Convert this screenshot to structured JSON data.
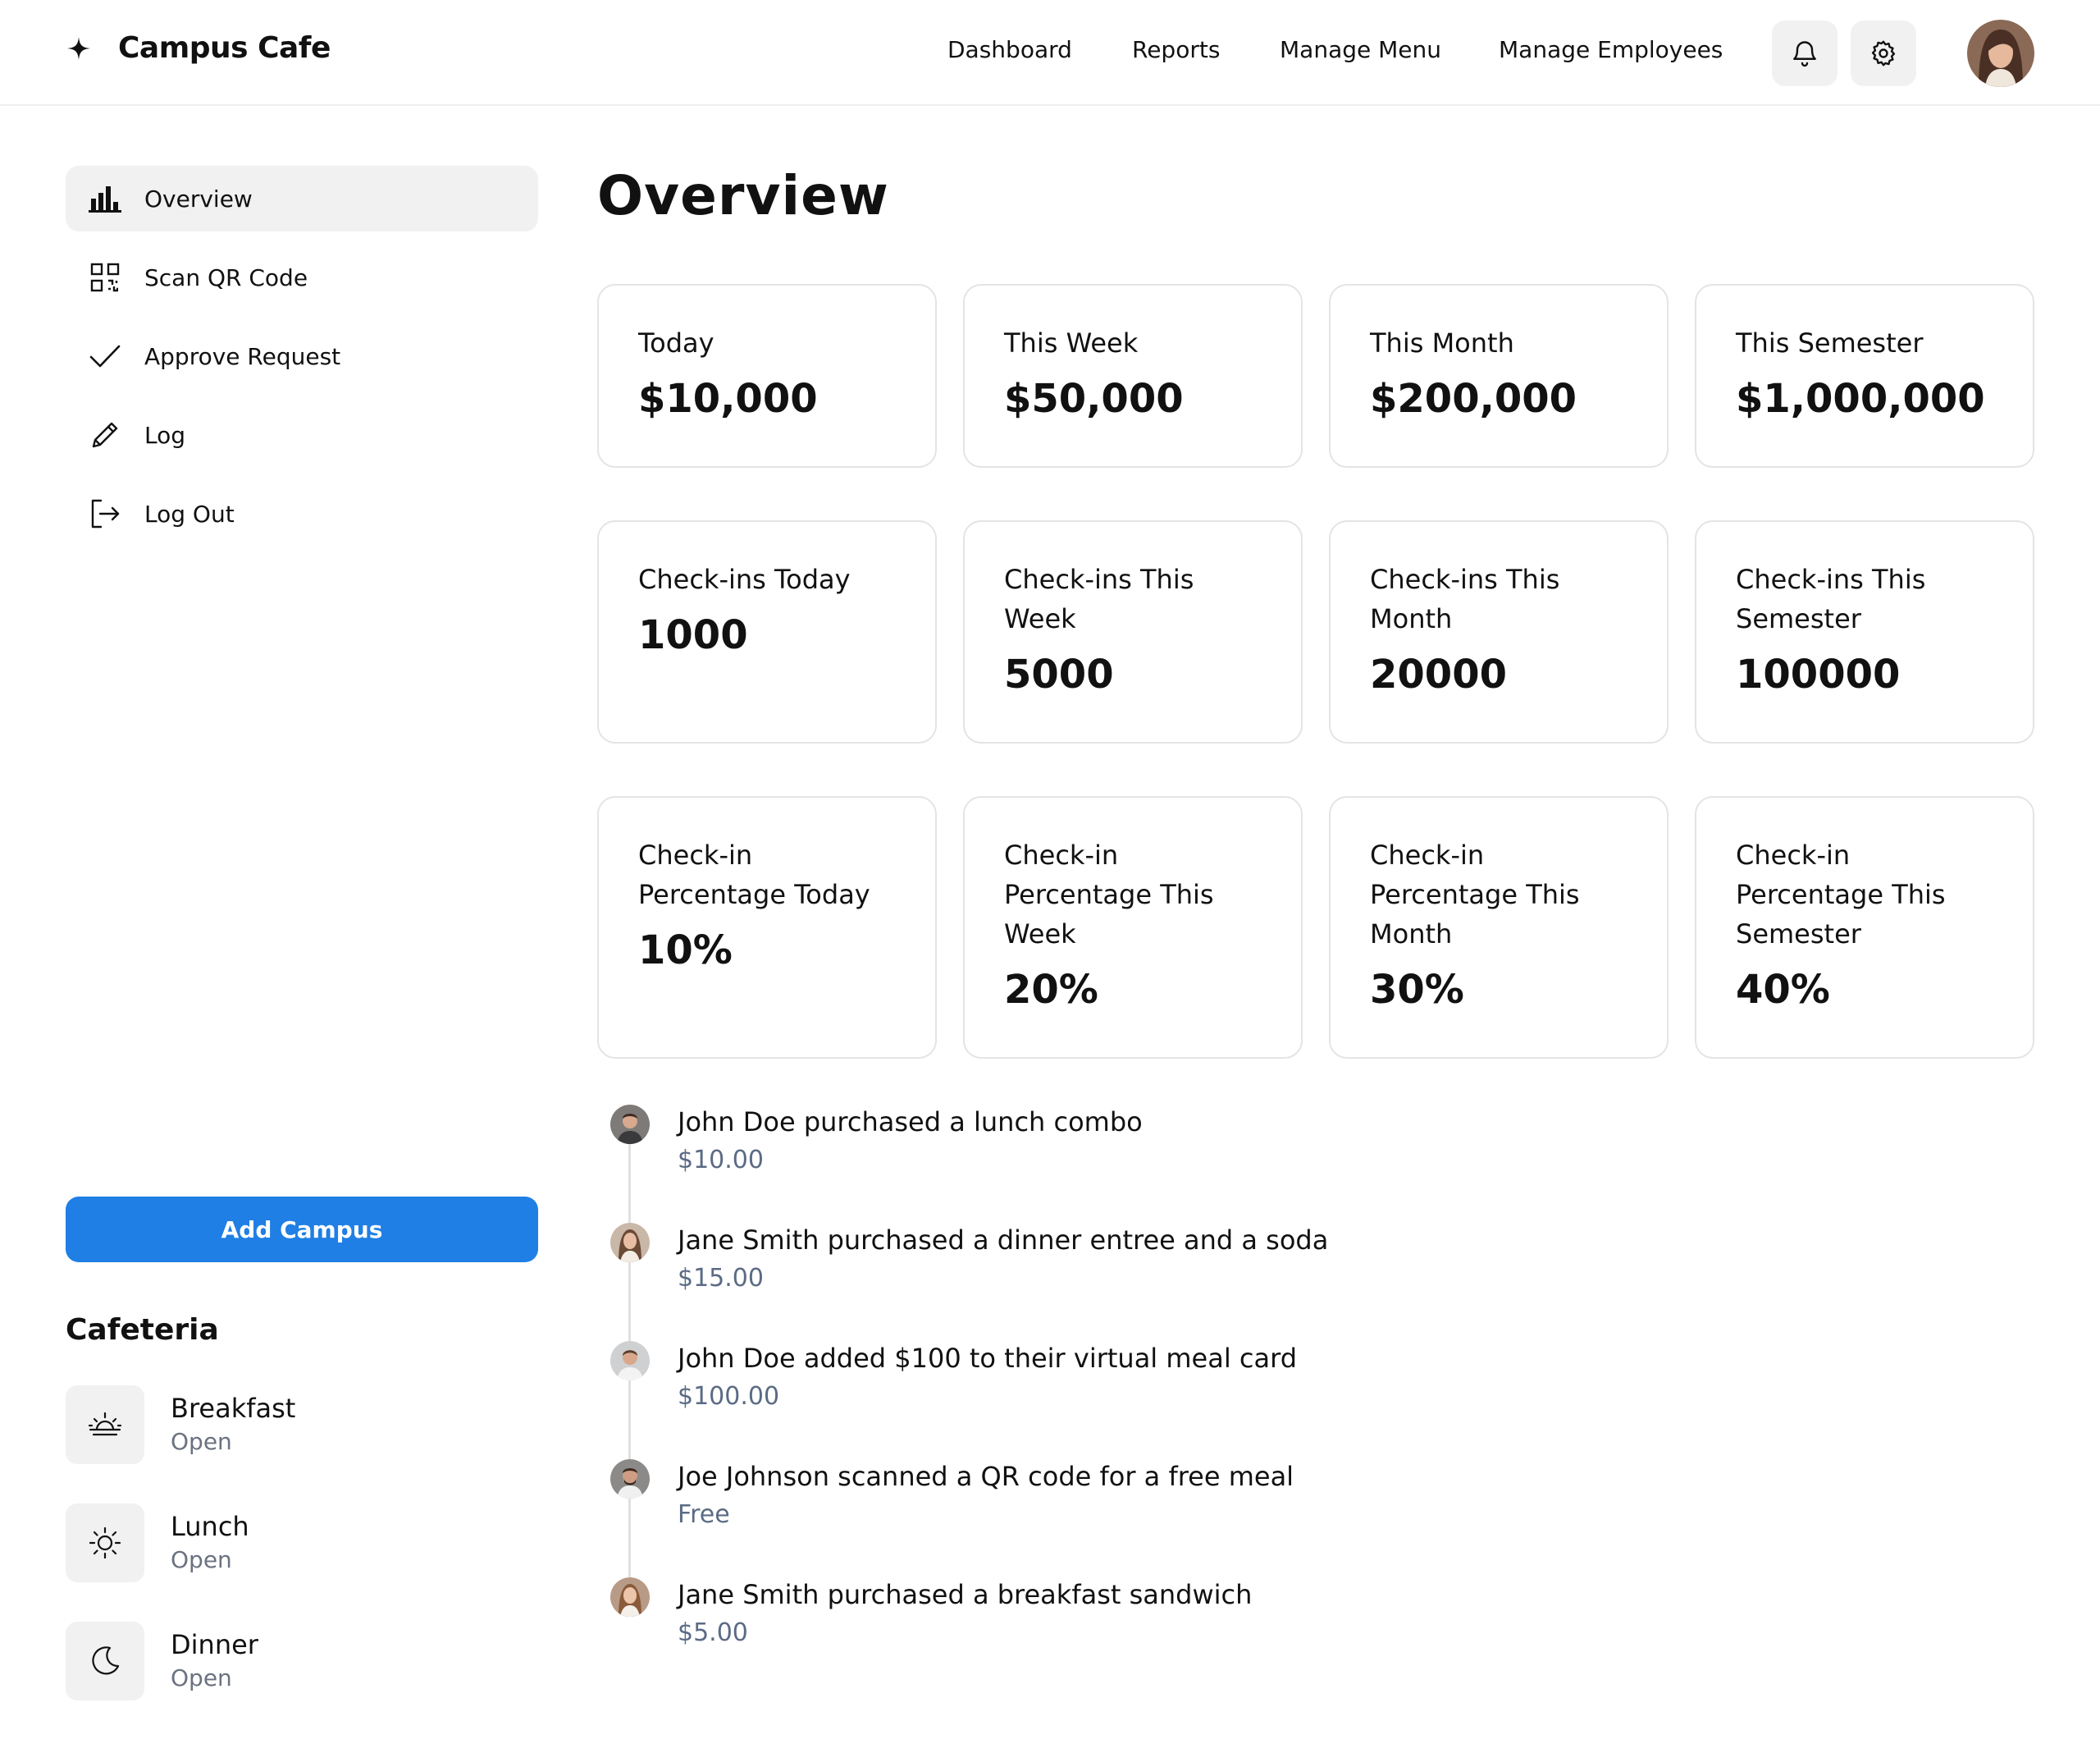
{
  "app": {
    "brand_name": "Campus Cafe",
    "brand_icon": "sparkle-icon"
  },
  "header": {
    "nav": [
      {
        "label": "Dashboard"
      },
      {
        "label": "Reports"
      },
      {
        "label": "Manage Menu"
      },
      {
        "label": "Manage Employees"
      }
    ],
    "icons": [
      "bell-icon",
      "gear-icon"
    ],
    "avatar": "user-avatar"
  },
  "sidebar": {
    "items": [
      {
        "label": "Overview",
        "icon": "bar-chart-icon",
        "active": true
      },
      {
        "label": "Scan QR Code",
        "icon": "qr-code-icon",
        "active": false
      },
      {
        "label": "Approve Request",
        "icon": "checkmark-icon",
        "active": false
      },
      {
        "label": "Log",
        "icon": "pencil-icon",
        "active": false
      },
      {
        "label": "Log Out",
        "icon": "logout-icon",
        "active": false
      }
    ],
    "add_button_label": "Add Campus",
    "cafeteria_heading": "Cafeteria",
    "meals": [
      {
        "name": "Breakfast",
        "status": "Open",
        "icon": "sunrise-icon"
      },
      {
        "name": "Lunch",
        "status": "Open",
        "icon": "sun-icon"
      },
      {
        "name": "Dinner",
        "status": "Open",
        "icon": "moon-icon"
      }
    ]
  },
  "main": {
    "title": "Overview",
    "revenue_cards": [
      {
        "label": "Today",
        "value": "$10,000"
      },
      {
        "label": "This Week",
        "value": "$50,000"
      },
      {
        "label": "This Month",
        "value": "$200,000"
      },
      {
        "label": "This Semester",
        "value": "$1,000,000"
      }
    ],
    "checkin_cards": [
      {
        "label": "Check-ins Today",
        "value": "1000"
      },
      {
        "label": "Check-ins This Week",
        "value": "5000"
      },
      {
        "label": "Check-ins This Month",
        "value": "20000"
      },
      {
        "label": "Check-ins This Semester",
        "value": "100000"
      }
    ],
    "percentage_cards": [
      {
        "label": "Check-in Percentage Today",
        "value": "10%"
      },
      {
        "label": "Check-in Percentage This Week",
        "value": "20%"
      },
      {
        "label": "Check-in Percentage This Month",
        "value": "30%"
      },
      {
        "label": "Check-in Percentage This Semester",
        "value": "40%"
      }
    ],
    "activity": [
      {
        "text": "John Doe purchased a lunch combo",
        "amount": "$10.00"
      },
      {
        "text": "Jane Smith purchased a dinner entree and a soda",
        "amount": "$15.00"
      },
      {
        "text": "John Doe added $100 to their virtual meal card",
        "amount": "$100.00"
      },
      {
        "text": "Joe Johnson scanned a QR code for a free meal",
        "amount": "Free"
      },
      {
        "text": "Jane Smith purchased a breakfast sandwich",
        "amount": "$5.00"
      }
    ]
  },
  "colors": {
    "accent": "#1f7fe5",
    "muted_text": "#6b7280",
    "amount_text": "#5b6b85",
    "card_border": "#e4e4e7",
    "chip_bg": "#f1f1f2"
  }
}
